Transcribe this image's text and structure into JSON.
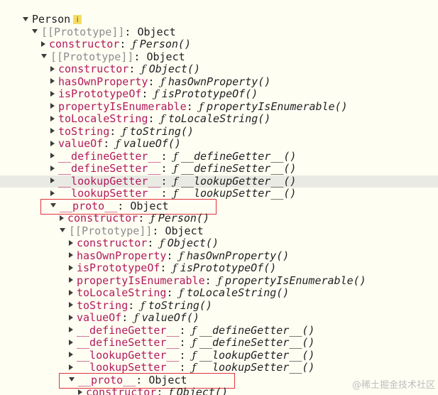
{
  "watermark": "@稀土掘金技术社区",
  "info_glyph": "i",
  "rows": [
    {
      "indent": 0,
      "arrow": "expanded",
      "kind": "plain",
      "key": "Person",
      "info": true
    },
    {
      "indent": 1,
      "arrow": "expanded",
      "kind": "internal",
      "key": "[[Prototype]]",
      "sep": ": ",
      "value": "Object"
    },
    {
      "indent": 2,
      "arrow": "collapsed",
      "kind": "prop",
      "key": "constructor",
      "sep": ": ",
      "fn": true,
      "value": "Person()"
    },
    {
      "indent": 2,
      "arrow": "expanded",
      "kind": "internal",
      "key": "[[Prototype]]",
      "sep": ": ",
      "value": "Object"
    },
    {
      "indent": 3,
      "arrow": "collapsed",
      "kind": "prop",
      "key": "constructor",
      "sep": ": ",
      "fn": true,
      "value": "Object()"
    },
    {
      "indent": 3,
      "arrow": "collapsed",
      "kind": "prop",
      "key": "hasOwnProperty",
      "sep": ": ",
      "fn": true,
      "value": "hasOwnProperty()"
    },
    {
      "indent": 3,
      "arrow": "collapsed",
      "kind": "prop",
      "key": "isPrototypeOf",
      "sep": ": ",
      "fn": true,
      "value": "isPrototypeOf()"
    },
    {
      "indent": 3,
      "arrow": "collapsed",
      "kind": "prop",
      "key": "propertyIsEnumerable",
      "sep": ": ",
      "fn": true,
      "value": "propertyIsEnumerable()"
    },
    {
      "indent": 3,
      "arrow": "collapsed",
      "kind": "prop",
      "key": "toLocaleString",
      "sep": ": ",
      "fn": true,
      "value": "toLocaleString()"
    },
    {
      "indent": 3,
      "arrow": "collapsed",
      "kind": "prop",
      "key": "toString",
      "sep": ": ",
      "fn": true,
      "value": "toString()"
    },
    {
      "indent": 3,
      "arrow": "collapsed",
      "kind": "prop",
      "key": "valueOf",
      "sep": ": ",
      "fn": true,
      "value": "valueOf()"
    },
    {
      "indent": 3,
      "arrow": "collapsed",
      "kind": "prop",
      "key": "__defineGetter__",
      "sep": ": ",
      "fn": true,
      "value": "__defineGetter__()"
    },
    {
      "indent": 3,
      "arrow": "collapsed",
      "kind": "prop",
      "key": "__defineSetter__",
      "sep": ": ",
      "fn": true,
      "value": "__defineSetter__()"
    },
    {
      "indent": 3,
      "arrow": "collapsed",
      "kind": "prop",
      "key": "__lookupGetter__",
      "sep": ": ",
      "fn": true,
      "value": "__lookupGetter__()",
      "hover": true
    },
    {
      "indent": 3,
      "arrow": "collapsed",
      "kind": "prop",
      "key": "__lookupSetter__",
      "sep": ": ",
      "fn": true,
      "value": "__lookupSetter__()"
    },
    {
      "indent": 3,
      "arrow": "expanded",
      "kind": "prop",
      "key": "__proto__",
      "sep": ": ",
      "value": "Object",
      "boxed": true
    },
    {
      "indent": 4,
      "arrow": "collapsed",
      "kind": "prop",
      "key": "constructor",
      "sep": ": ",
      "fn": true,
      "value": "Person()"
    },
    {
      "indent": 4,
      "arrow": "expanded",
      "kind": "internal",
      "key": "[[Prototype]]",
      "sep": ": ",
      "value": "Object"
    },
    {
      "indent": 5,
      "arrow": "collapsed",
      "kind": "prop",
      "key": "constructor",
      "sep": ": ",
      "fn": true,
      "value": "Object()"
    },
    {
      "indent": 5,
      "arrow": "collapsed",
      "kind": "prop",
      "key": "hasOwnProperty",
      "sep": ": ",
      "fn": true,
      "value": "hasOwnProperty()"
    },
    {
      "indent": 5,
      "arrow": "collapsed",
      "kind": "prop",
      "key": "isPrototypeOf",
      "sep": ": ",
      "fn": true,
      "value": "isPrototypeOf()"
    },
    {
      "indent": 5,
      "arrow": "collapsed",
      "kind": "prop",
      "key": "propertyIsEnumerable",
      "sep": ": ",
      "fn": true,
      "value": "propertyIsEnumerable()"
    },
    {
      "indent": 5,
      "arrow": "collapsed",
      "kind": "prop",
      "key": "toLocaleString",
      "sep": ": ",
      "fn": true,
      "value": "toLocaleString()"
    },
    {
      "indent": 5,
      "arrow": "collapsed",
      "kind": "prop",
      "key": "toString",
      "sep": ": ",
      "fn": true,
      "value": "toString()"
    },
    {
      "indent": 5,
      "arrow": "collapsed",
      "kind": "prop",
      "key": "valueOf",
      "sep": ": ",
      "fn": true,
      "value": "valueOf()"
    },
    {
      "indent": 5,
      "arrow": "collapsed",
      "kind": "prop",
      "key": "__defineGetter__",
      "sep": ": ",
      "fn": true,
      "value": "__defineGetter__()"
    },
    {
      "indent": 5,
      "arrow": "collapsed",
      "kind": "prop",
      "key": "__defineSetter__",
      "sep": ": ",
      "fn": true,
      "value": "__defineSetter__()"
    },
    {
      "indent": 5,
      "arrow": "collapsed",
      "kind": "prop",
      "key": "__lookupGetter__",
      "sep": ": ",
      "fn": true,
      "value": "__lookupGetter__()"
    },
    {
      "indent": 5,
      "arrow": "collapsed",
      "kind": "prop",
      "key": "__lookupSetter__",
      "sep": ": ",
      "fn": true,
      "value": "__lookupSetter__()"
    },
    {
      "indent": 5,
      "arrow": "expanded",
      "kind": "prop",
      "key": "__proto__",
      "sep": ": ",
      "value": "Object",
      "boxed": true
    },
    {
      "indent": 6,
      "arrow": "collapsed",
      "kind": "prop",
      "key": "constructor",
      "sep": ": ",
      "fn": true,
      "value": "Object()"
    }
  ],
  "colors": {
    "background": "#fffef3",
    "property_key": "#b21a5c",
    "internal_key": "#8c8c8c",
    "highlight_box": "#e0343b",
    "hover_row": "#eaeae4"
  }
}
